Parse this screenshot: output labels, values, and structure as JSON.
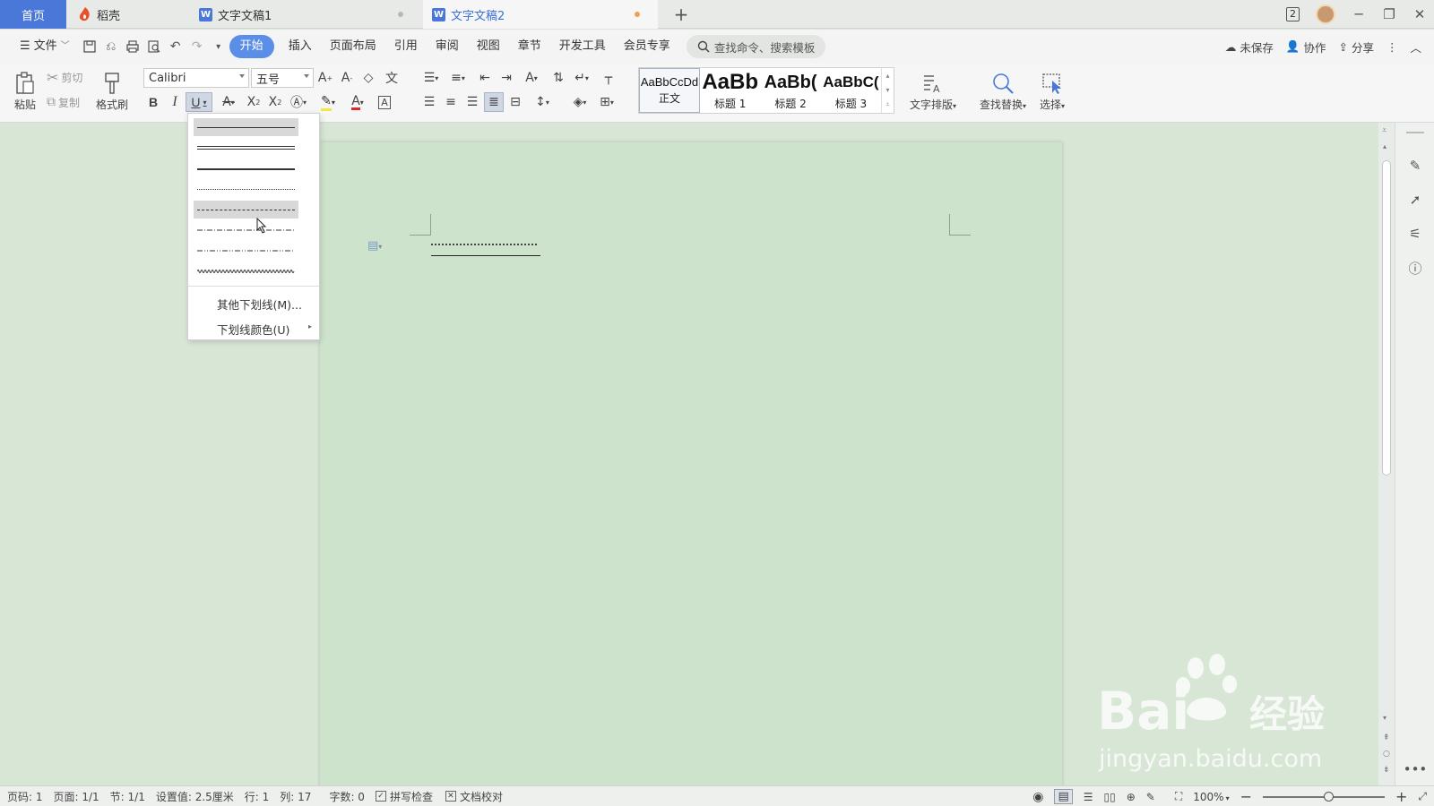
{
  "tabs": {
    "home": "首页",
    "daoke": "稻壳",
    "doc1": "文字文稿1",
    "doc2": "文字文稿2",
    "new_tab": "+",
    "page_count": "2"
  },
  "menu": {
    "file": "文件",
    "items": [
      "开始",
      "插入",
      "页面布局",
      "引用",
      "审阅",
      "视图",
      "章节",
      "开发工具",
      "会员专享"
    ],
    "search_placeholder": "查找命令、搜索模板",
    "unsaved": "未保存",
    "collab": "协作",
    "share": "分享"
  },
  "ribbon": {
    "paste": "粘贴",
    "cut": "剪切",
    "copy": "复制",
    "format_painter": "格式刷",
    "font_name": "Calibri",
    "font_size": "五号",
    "styles": [
      {
        "preview": "AaBbCcDd",
        "name": "正文"
      },
      {
        "preview": "AaBb",
        "name": "标题 1"
      },
      {
        "preview": "AaBb(",
        "name": "标题 2"
      },
      {
        "preview": "AaBbC(",
        "name": "标题 3"
      }
    ],
    "text_layout": "文字排版",
    "find_replace": "查找替换",
    "select": "选择"
  },
  "underline_menu": {
    "other": "其他下划线(M)...",
    "color": "下划线颜色(U)"
  },
  "status": {
    "page_code": "页码: 1",
    "pages": "页面: 1/1",
    "section": "节: 1/1",
    "setting": "设置值: 2.5厘米",
    "row": "行: 1",
    "col": "列: 17",
    "words": "字数: 0",
    "spell": "拼写检查",
    "proof": "文档校对",
    "zoom": "100%"
  },
  "watermark": {
    "brand": "Bai",
    "cn": "经验",
    "url": "jingyan.baidu.com"
  },
  "colors": {
    "accent": "#4a78d8",
    "page_bg": "#cde3cc",
    "area_bg": "#d8e6d6"
  }
}
